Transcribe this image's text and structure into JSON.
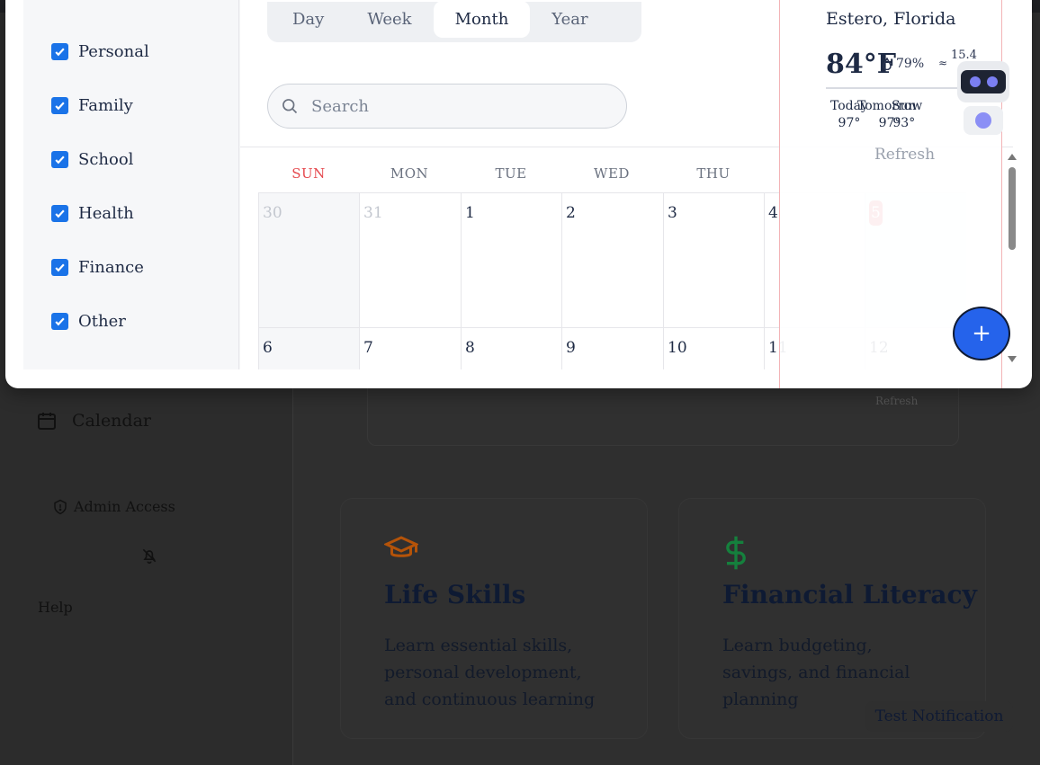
{
  "filters": [
    {
      "label": "Personal",
      "checked": true
    },
    {
      "label": "Family",
      "checked": true
    },
    {
      "label": "School",
      "checked": true
    },
    {
      "label": "Health",
      "checked": true
    },
    {
      "label": "Finance",
      "checked": true
    },
    {
      "label": "Other",
      "checked": true
    }
  ],
  "views": {
    "day": "Day",
    "week": "Week",
    "month": "Month",
    "year": "Year",
    "active": "Month"
  },
  "search": {
    "placeholder": "Search"
  },
  "weekdays": {
    "sun": "SUN",
    "mon": "MON",
    "tue": "TUE",
    "wed": "WED",
    "thu": "THU"
  },
  "weeks": [
    [
      "30",
      "31",
      "1",
      "2",
      "3",
      "4",
      "5"
    ],
    [
      "6",
      "7",
      "8",
      "9",
      "10",
      "11",
      "12"
    ]
  ],
  "today": "5",
  "weather": {
    "city": "Estero, Florida",
    "temp": "84°F",
    "humidity": "79%",
    "wind": "15.4",
    "forecast": [
      {
        "day": "Today",
        "temp": "97°"
      },
      {
        "day": "Tomorrow",
        "temp": "97°"
      },
      {
        "day": "Sun",
        "temp": "93°"
      }
    ],
    "refresh": "Refresh"
  },
  "fab": {
    "label": "+"
  },
  "background": {
    "calendar_nav": "Calendar",
    "admin_access": "Admin Access",
    "help": "Help",
    "weather_refresh": "Refresh",
    "weather_mini": [
      "97",
      "97",
      "93"
    ],
    "cards": [
      {
        "title": "Life Skills",
        "description": "Learn essential skills, personal development, and continuous learning",
        "icon": "graduation-cap-icon",
        "icon_color": "#b45309"
      },
      {
        "title": "Financial Literacy",
        "description": "Learn budgeting, savings, and financial planning",
        "icon": "dollar-icon",
        "icon_color": "#15803d"
      }
    ],
    "test_notification": "Test Notification"
  },
  "colors": {
    "accent": "#2563eb",
    "checkbox": "#1a73e8",
    "today": "#e5484d",
    "sunday": "#e5484d",
    "bot_eye": "#7b7ff2"
  }
}
